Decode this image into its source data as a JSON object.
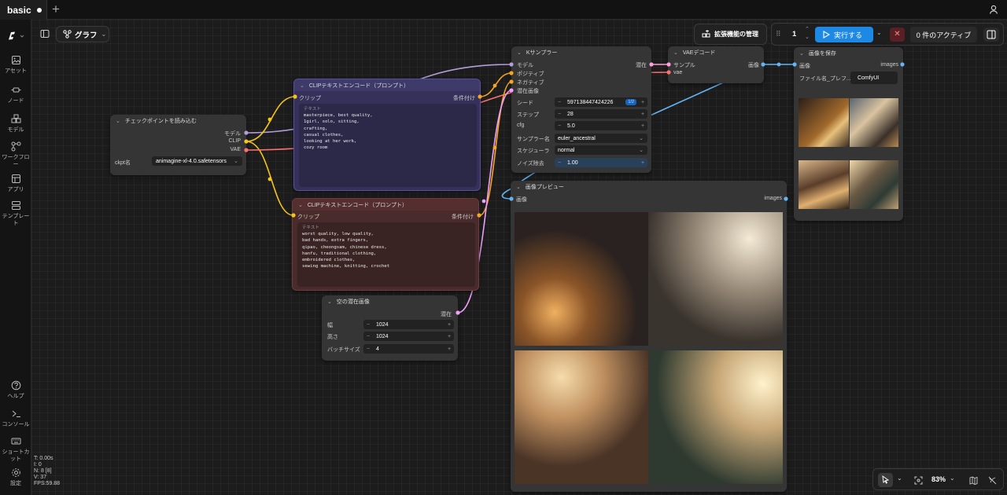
{
  "tabbar": {
    "tab_name": "basic"
  },
  "sidebar": {
    "items": [
      {
        "label": "アセット"
      },
      {
        "label": "ノード"
      },
      {
        "label": "モデル"
      },
      {
        "label": "ワークフロー"
      },
      {
        "label": "アプリ"
      },
      {
        "label": "テンプレート"
      },
      {
        "label": "ヘルプ"
      },
      {
        "label": "コンソール"
      },
      {
        "label": "ショートカット"
      },
      {
        "label": "設定"
      }
    ]
  },
  "toolbar": {
    "view_label": "グラフ",
    "extensions_label": "拡張機能の管理",
    "queue_count": "1",
    "run_label": "実行する",
    "active_label": "0 件のアクティブ"
  },
  "nodes": {
    "checkpoint": {
      "title": "チェックポイントを読み込む",
      "out_model": "モデル",
      "out_clip": "CLIP",
      "out_vae": "VAE",
      "ckpt_label": "ckpt名",
      "ckpt_value": "animagine-xl-4.0.safetensors"
    },
    "clip_pos": {
      "title": "CLIPテキストエンコード（プロンプト）",
      "in_clip": "クリップ",
      "out_cond": "条件付け",
      "text_label": "テキスト",
      "text": "masterpiece, best quality,\n1girl, solo, sitting,\ncrafting,\ncasual clothes,\nlooking at her work,\ncozy room"
    },
    "clip_neg": {
      "title": "CLIPテキストエンコード（プロンプト）",
      "in_clip": "クリップ",
      "out_cond": "条件付け",
      "text_label": "テキスト",
      "text": "worst quality, low quality,\nbad hands, extra fingers,\nqipao, cheongsam, chinese dress,\nhanfu, traditional clothing,\nembroidered clothes,\nsewing machine, knitting, crochet"
    },
    "latent": {
      "title": "空の潜在画像",
      "out_latent": "潜在",
      "width_label": "幅",
      "width": "1024",
      "height_label": "高さ",
      "height": "1024",
      "batch_label": "バッチサイズ",
      "batch": "4"
    },
    "ksampler": {
      "title": "Kサンプラー",
      "in_model": "モデル",
      "in_pos": "ポジティブ",
      "in_neg": "ネガティブ",
      "in_latent": "潜在画像",
      "out_latent": "潜在",
      "seed_label": "シード",
      "seed": "597138447424226",
      "seed_badge": "1/2",
      "steps_label": "ステップ",
      "steps": "28",
      "cfg_label": "cfg",
      "cfg": "5.0",
      "sampler_label": "サンプラー名",
      "sampler": "euler_ancestral",
      "scheduler_label": "スケジューラ",
      "scheduler": "normal",
      "denoise_label": "ノイズ除去",
      "denoise": "1.00"
    },
    "vaedecode": {
      "title": "VAEデコード",
      "in_samples": "サンプル",
      "in_vae": "vae",
      "out_image": "画像"
    },
    "save": {
      "title": "画像を保存",
      "in_images": "画像",
      "out_images": "images",
      "prefix_label": "ファイル名_プレフ...",
      "prefix": "ComfyUI"
    },
    "preview": {
      "title": "画像プレビュー",
      "in_images": "画像",
      "out_images": "images"
    }
  },
  "stats": {
    "t": "T: 0.00s",
    "i": "I: 0",
    "n": "N: 8 [8]",
    "v": "V: 37",
    "fps": "FPS:59.88"
  },
  "bottom": {
    "zoom": "83%"
  }
}
